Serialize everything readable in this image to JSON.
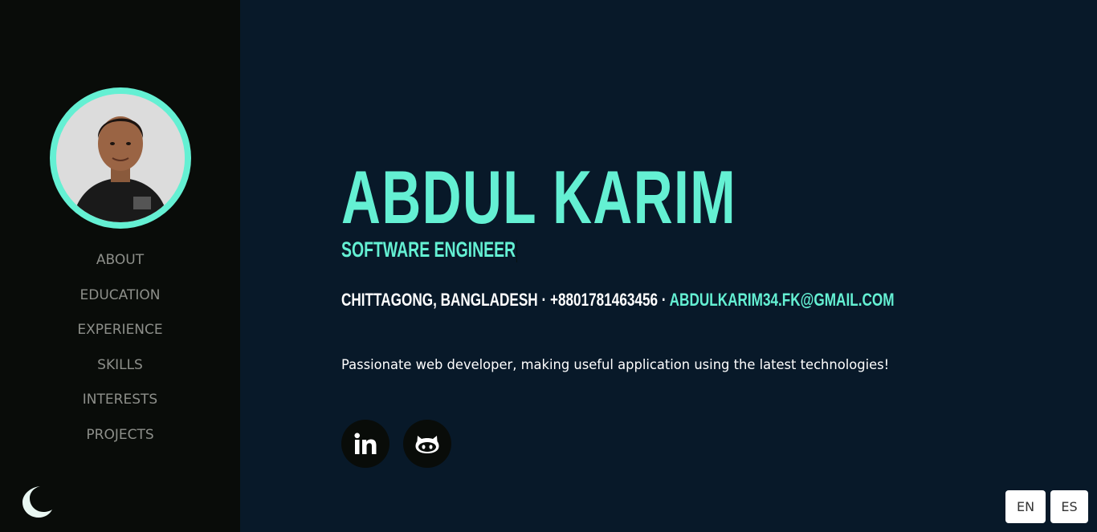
{
  "sidebar": {
    "nav": [
      {
        "label": "ABOUT"
      },
      {
        "label": "EDUCATION"
      },
      {
        "label": "EXPERIENCE"
      },
      {
        "label": "SKILLS"
      },
      {
        "label": "INTERESTS"
      },
      {
        "label": "PROJECTS"
      }
    ],
    "theme_toggle_icon": "moon-icon"
  },
  "hero": {
    "name": "ABDUL KARIM",
    "title": "SOFTWARE ENGINEER",
    "location": "CHITTAGONG, BANGLADESH",
    "separator": " · ",
    "phone": "+8801781463456",
    "email": "ABDULKARIM34.FK@GMAIL.COM",
    "tagline": "Passionate web developer, making useful application using the latest technologies!"
  },
  "social": [
    {
      "icon": "linkedin-icon"
    },
    {
      "icon": "github-icon"
    }
  ],
  "language": {
    "en": "EN",
    "es": "ES"
  },
  "colors": {
    "accent": "#64f0d3",
    "sidebar_bg": "#090c09",
    "main_bg": "#081929",
    "nav_text": "#8d8f8a"
  }
}
